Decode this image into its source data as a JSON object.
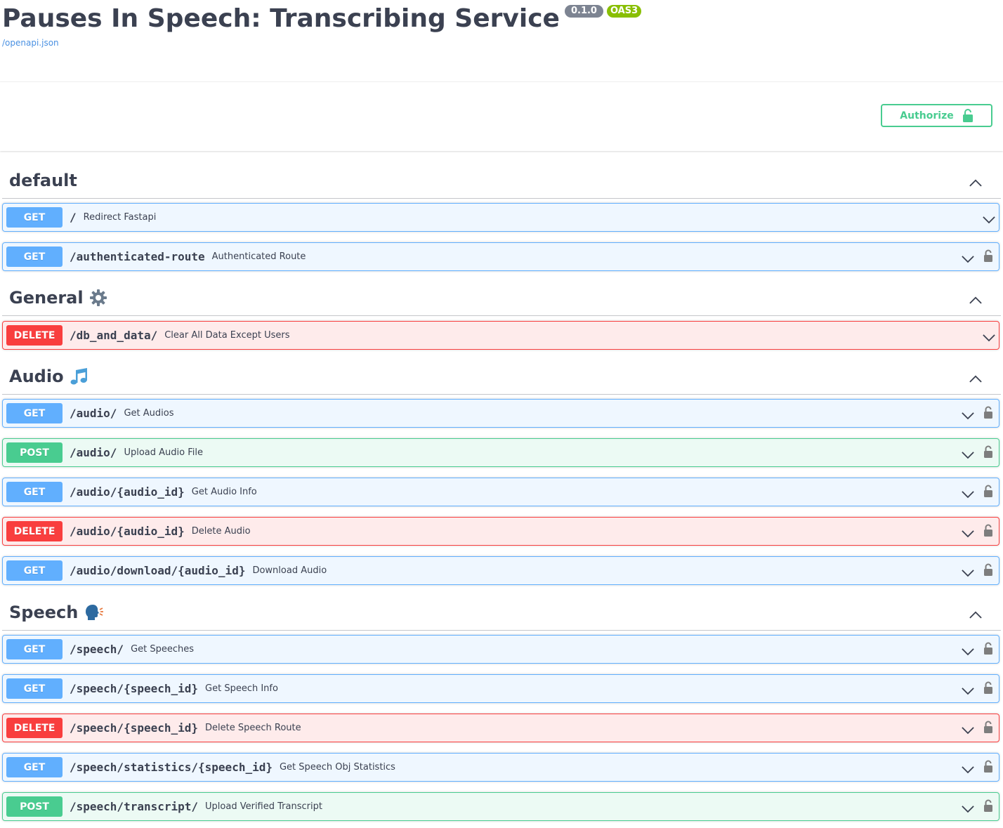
{
  "info": {
    "title": "Pauses In Speech: Transcribing Service",
    "version": "0.1.0",
    "oas": "OAS3",
    "spec_link": "/openapi.json"
  },
  "authorize": {
    "label": "Authorize"
  },
  "tags": [
    {
      "name": "default",
      "emoji": "",
      "operations": [
        {
          "method": "GET",
          "path": "/",
          "summary": "Redirect Fastapi",
          "locked": false
        },
        {
          "method": "GET",
          "path": "/authenticated-route",
          "summary": "Authenticated Route",
          "locked": true
        }
      ]
    },
    {
      "name": "General",
      "emoji": "gear-icon",
      "operations": [
        {
          "method": "DELETE",
          "path": "/db_and_data/",
          "summary": "Clear All Data Except Users",
          "locked": false
        }
      ]
    },
    {
      "name": "Audio",
      "emoji": "music-note-icon",
      "operations": [
        {
          "method": "GET",
          "path": "/audio/",
          "summary": "Get Audios",
          "locked": true
        },
        {
          "method": "POST",
          "path": "/audio/",
          "summary": "Upload Audio File",
          "locked": true
        },
        {
          "method": "GET",
          "path": "/audio/{audio_id}",
          "summary": "Get Audio Info",
          "locked": true
        },
        {
          "method": "DELETE",
          "path": "/audio/{audio_id}",
          "summary": "Delete Audio",
          "locked": true
        },
        {
          "method": "GET",
          "path": "/audio/download/{audio_id}",
          "summary": "Download Audio",
          "locked": true
        }
      ]
    },
    {
      "name": "Speech",
      "emoji": "speaking-head-icon",
      "operations": [
        {
          "method": "GET",
          "path": "/speech/",
          "summary": "Get Speeches",
          "locked": true
        },
        {
          "method": "GET",
          "path": "/speech/{speech_id}",
          "summary": "Get Speech Info",
          "locked": true
        },
        {
          "method": "DELETE",
          "path": "/speech/{speech_id}",
          "summary": "Delete Speech Route",
          "locked": true
        },
        {
          "method": "GET",
          "path": "/speech/statistics/{speech_id}",
          "summary": "Get Speech Obj Statistics",
          "locked": true
        },
        {
          "method": "POST",
          "path": "/speech/transcript/",
          "summary": "Upload Verified Transcript",
          "locked": true
        }
      ]
    }
  ],
  "colors": {
    "get": "#61affe",
    "post": "#49cc90",
    "delete": "#f93e3e",
    "text": "#3b4151"
  }
}
